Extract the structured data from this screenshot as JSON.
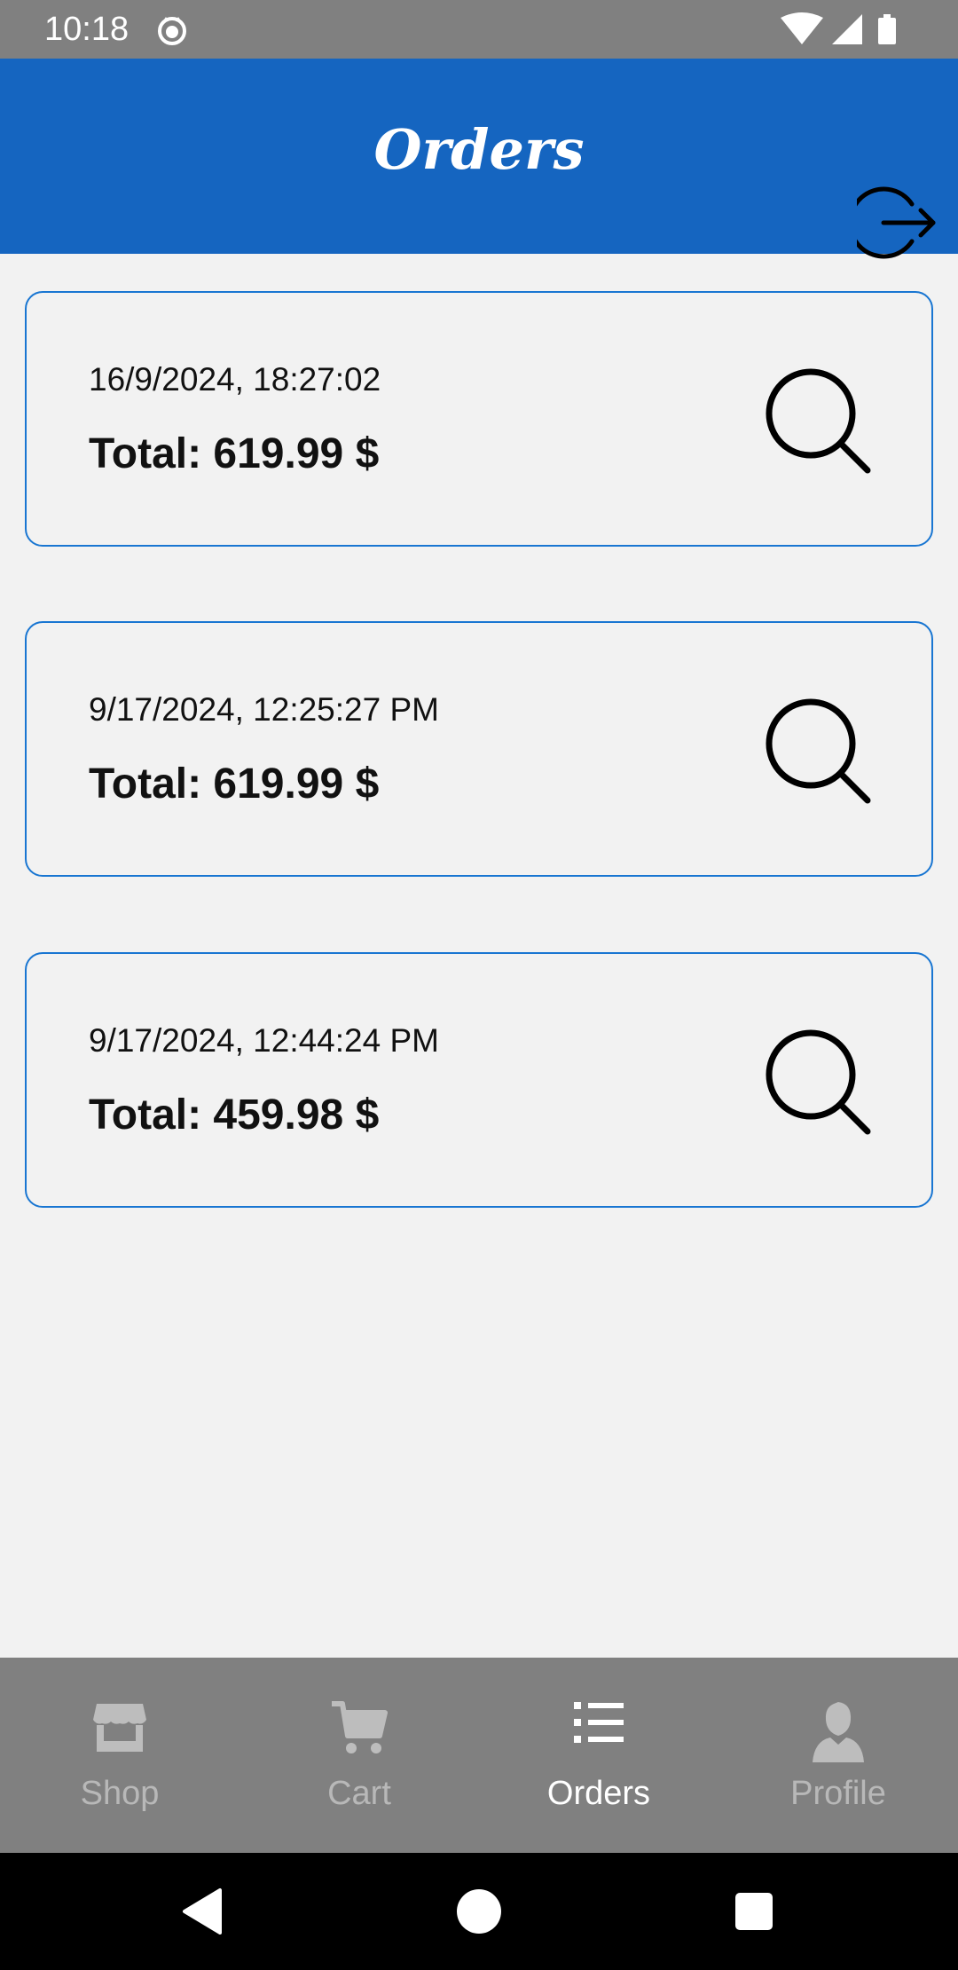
{
  "status_bar": {
    "time": "10:18",
    "icons": [
      "cat-notification-icon",
      "wifi-icon",
      "signal-icon",
      "battery-icon"
    ]
  },
  "app_bar": {
    "title": "Orders",
    "background": "#1565c0",
    "logout_icon": "logout-icon"
  },
  "orders": [
    {
      "date": "16/9/2024, 18:27:02",
      "total": "Total: 619.99 $"
    },
    {
      "date": "9/17/2024, 12:25:27 PM",
      "total": "Total: 619.99 $"
    },
    {
      "date": "9/17/2024, 12:44:24 PM",
      "total": "Total: 459.98 $"
    }
  ],
  "bottom_nav": {
    "items": [
      {
        "label": "Shop",
        "icon": "store-icon",
        "active": false
      },
      {
        "label": "Cart",
        "icon": "cart-icon",
        "active": false
      },
      {
        "label": "Orders",
        "icon": "list-icon",
        "active": true
      },
      {
        "label": "Profile",
        "icon": "person-icon",
        "active": false
      }
    ]
  },
  "colors": {
    "accent": "#1565c0",
    "card_border": "#1976d2",
    "nav_background": "#808080"
  }
}
